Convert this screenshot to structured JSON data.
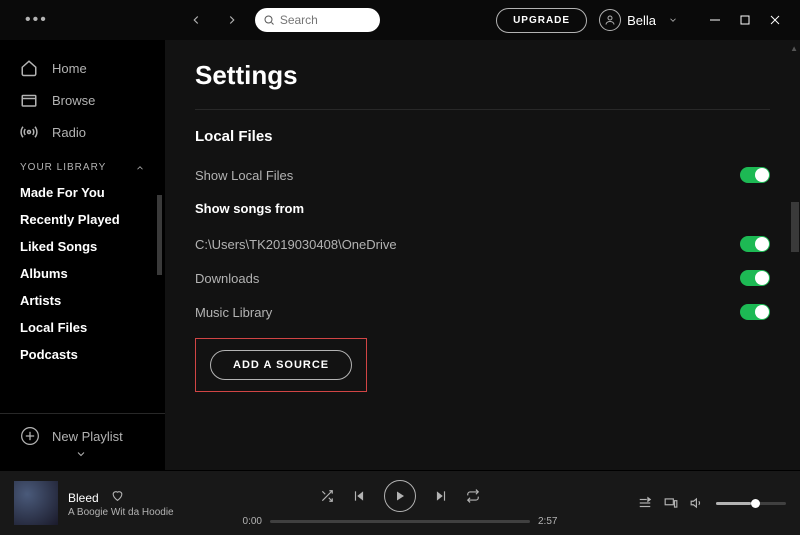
{
  "header": {
    "search_placeholder": "Search",
    "upgrade": "UPGRADE",
    "username": "Bella"
  },
  "sidebar": {
    "nav": [
      {
        "label": "Home"
      },
      {
        "label": "Browse"
      },
      {
        "label": "Radio"
      }
    ],
    "library_header": "YOUR LIBRARY",
    "library": [
      "Made For You",
      "Recently Played",
      "Liked Songs",
      "Albums",
      "Artists",
      "Local Files",
      "Podcasts"
    ],
    "new_playlist": "New Playlist"
  },
  "main": {
    "title": "Settings",
    "local_files_header": "Local Files",
    "show_local_files": "Show Local Files",
    "show_songs_from": "Show songs from",
    "sources": [
      "C:\\Users\\TK2019030408\\OneDrive",
      "Downloads",
      "Music Library"
    ],
    "add_source": "ADD A SOURCE"
  },
  "player": {
    "track": "Bleed",
    "artist": "A Boogie Wit da Hoodie",
    "elapsed": "0:00",
    "duration": "2:57"
  }
}
